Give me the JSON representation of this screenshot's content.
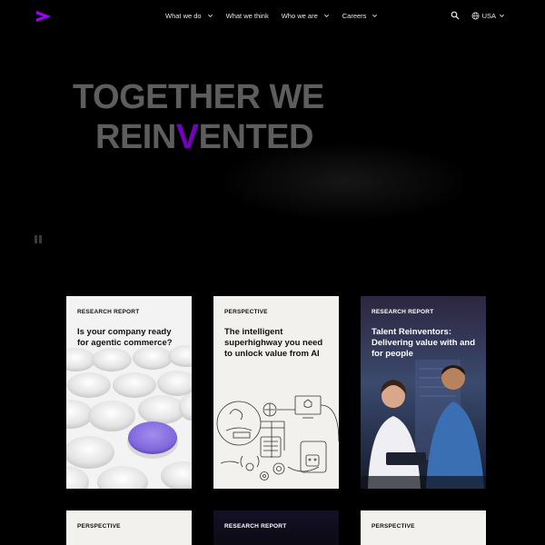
{
  "header": {
    "logo_icon": "accenture-arrow-logo",
    "nav": [
      {
        "label": "What we do",
        "has_dropdown": true
      },
      {
        "label": "What we think",
        "has_dropdown": false
      },
      {
        "label": "Who we are",
        "has_dropdown": true
      },
      {
        "label": "Careers",
        "has_dropdown": true
      }
    ],
    "search_icon": "search-icon",
    "locale": {
      "label": "USA",
      "icon": "globe-icon"
    }
  },
  "hero": {
    "line1": "TOGETHER WE",
    "line2_pre": "REIN",
    "line2_accent": "V",
    "line2_post": "ENTED",
    "accent_color": "#7500c0",
    "pause_icon": "pause-icon"
  },
  "cards": [
    {
      "tag": "RESEARCH REPORT",
      "title": "Is your company ready for agentic commerce?"
    },
    {
      "tag": "PERSPECTIVE",
      "title": "The intelligent superhighway you need to unlock value from AI"
    },
    {
      "tag": "RESEARCH REPORT",
      "title": "Talent Reinventors: Delivering value with and for people"
    },
    {
      "tag": "PERSPECTIVE",
      "title": ""
    },
    {
      "tag": "RESEARCH REPORT",
      "title": ""
    },
    {
      "tag": "PERSPECTIVE",
      "title": ""
    }
  ],
  "colors": {
    "brand": "#a100ff",
    "background": "#000000"
  }
}
